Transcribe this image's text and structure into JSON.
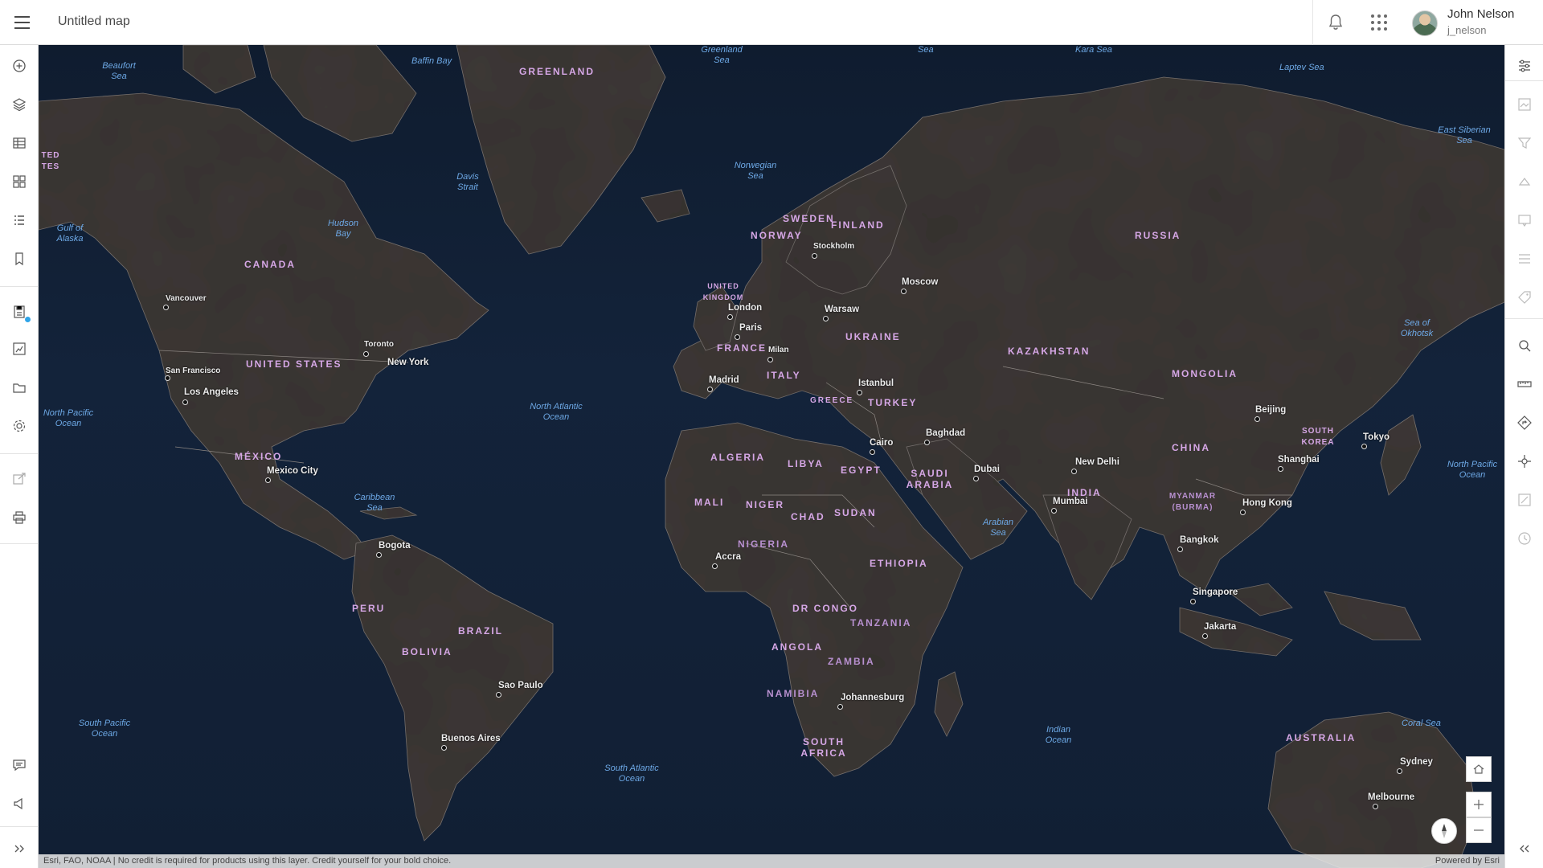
{
  "header": {
    "title": "Untitled map",
    "user_name": "John Nelson",
    "user_handle": "j_nelson"
  },
  "left_toolbar": [
    "add-icon",
    "layers-icon",
    "table-icon",
    "basemap-icon",
    "legend-icon",
    "bookmark-icon",
    "save-icon",
    "create-app-icon",
    "open-icon",
    "settings-icon",
    "share-icon",
    "print-icon",
    "feedback-icon",
    "whats-new-icon",
    "expand-icon"
  ],
  "right_toolbar": [
    "properties-icon",
    "styles-icon",
    "filter-icon",
    "effects-icon",
    "pop-ups-icon",
    "configure-icon",
    "labels-icon",
    "search-icon",
    "measure-icon",
    "directions-icon",
    "location-icon",
    "sketch-icon",
    "time-icon",
    "collapse-icon"
  ],
  "map": {
    "countries": [
      "CANADA",
      "UNITED STATES",
      "MÉXICO",
      "BRAZIL",
      "PERU",
      "BOLIVIA",
      "GREENLAND",
      "NORWAY",
      "SWEDEN",
      "FINLAND",
      "UNITED KINGDOM",
      "FRANCE",
      "ITALY",
      "GREECE",
      "UKRAINE",
      "TURKEY",
      "RUSSIA",
      "KAZAKHSTAN",
      "MONGOLIA",
      "CHINA",
      "SOUTH KOREA",
      "INDIA",
      "MYANMAR (BURMA)",
      "SAUDI ARABIA",
      "EGYPT",
      "LIBYA",
      "ALGERIA",
      "MALI",
      "NIGER",
      "CHAD",
      "SUDAN",
      "NIGERIA",
      "ETHIOPIA",
      "DR CONGO",
      "TANZANIA",
      "ANGOLA",
      "ZAMBIA",
      "NAMIBIA",
      "SOUTH AFRICA",
      "AUSTRALIA",
      "TED TES"
    ],
    "oceans": [
      "Beaufort Sea",
      "Baffin Bay",
      "Greenland Sea",
      "Kara Sea",
      "Laptev Sea",
      "East Siberian Sea",
      "Norwegian Sea",
      "Davis Strait",
      "Hudson Bay",
      "Gulf of Alaska",
      "Sea of Okhotsk",
      "North Atlantic Ocean",
      "North Pacific Ocean",
      "North Pacific Ocean",
      "Caribbean Sea",
      "Arabian Sea",
      "South Pacific Ocean",
      "South Atlantic Ocean",
      "Indian Ocean",
      "Coral Sea",
      "Sea"
    ],
    "cities": [
      "Vancouver",
      "Toronto",
      "New York",
      "San Francisco",
      "Los Angeles",
      "Mexico City",
      "Bogota",
      "Sao Paulo",
      "Buenos Aires",
      "London",
      "Paris",
      "Madrid",
      "Milan",
      "Stockholm",
      "Warsaw",
      "Moscow",
      "Istanbul",
      "Baghdad",
      "Cairo",
      "Dubai",
      "New Delhi",
      "Mumbai",
      "Beijing",
      "Tokyo",
      "Shanghai",
      "Hong Kong",
      "Bangkok",
      "Singapore",
      "Jakarta",
      "Accra",
      "Johannesburg",
      "Sydney",
      "Melbourne"
    ]
  },
  "attribution": {
    "left": "Esri, FAO, NOAA | No credit is required for products using this layer. Credit yourself for your bold choice.",
    "right": "Powered by Esri"
  }
}
